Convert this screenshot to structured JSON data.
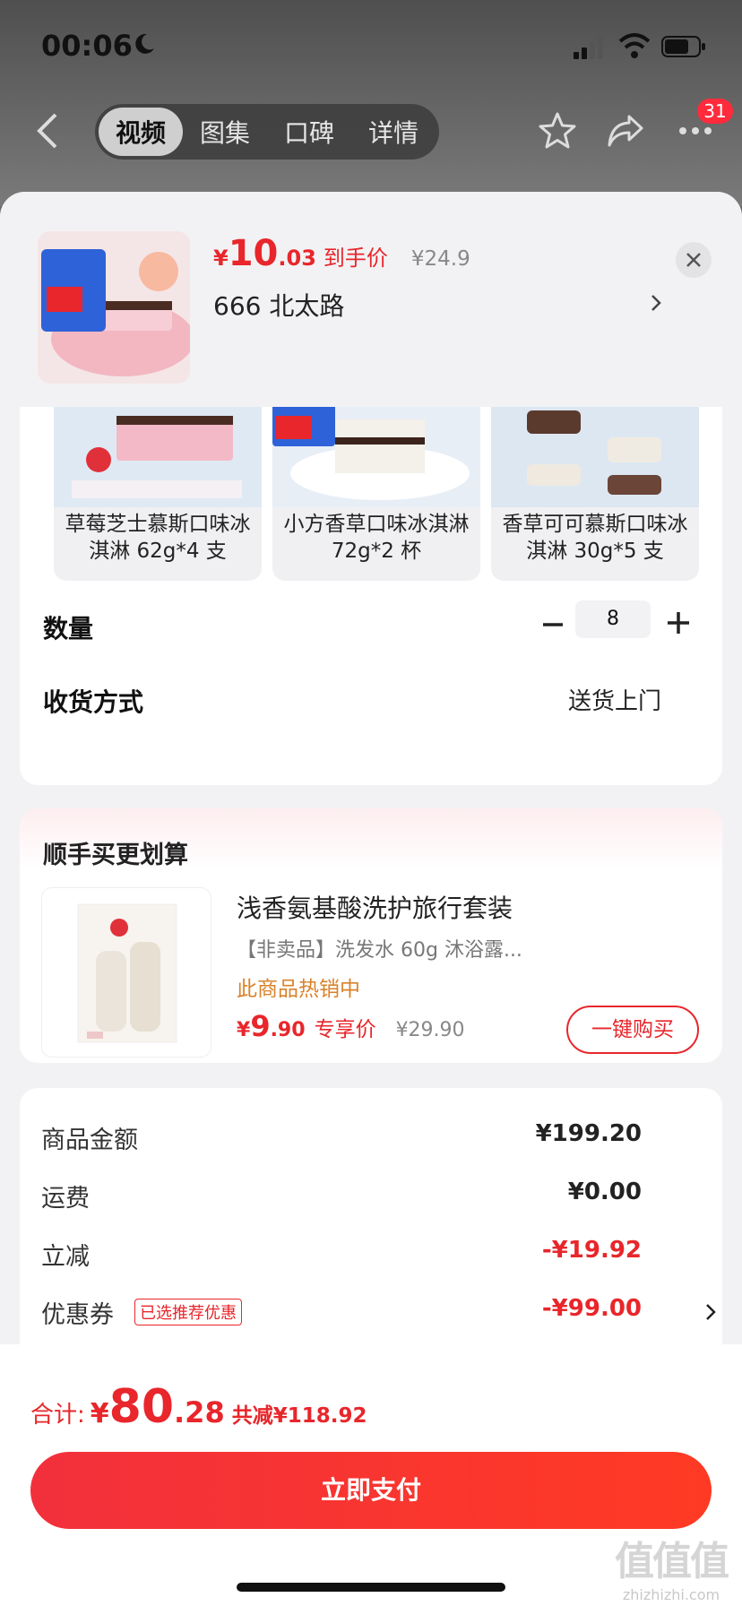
{
  "status_bar": {
    "time": "00:06"
  },
  "nav": {
    "tabs": [
      "视频",
      "图集",
      "口碑",
      "详情"
    ],
    "active_tab": "视频",
    "notification_count": "31"
  },
  "product": {
    "price_symbol": "¥",
    "price_int": "10",
    "price_dec": ".03",
    "price_label": "到手价",
    "original_price": "¥24.9",
    "store_name": "666  北太路"
  },
  "variants": [
    {
      "label": "草莓芝士慕斯口味冰淇淋 62g*4 支"
    },
    {
      "label": "小方香草口味冰淇淋 72g*2 杯"
    },
    {
      "label": "香草可可慕斯口味冰淇淋 30g*5 支"
    }
  ],
  "quantity": {
    "label": "数量",
    "value": "8"
  },
  "delivery": {
    "label": "收货方式",
    "value": "送货上门"
  },
  "addon": {
    "title": "顺手买更划算",
    "name": "浅香氨基酸洗护旅行套装",
    "desc": "【非卖品】洗发水 60g 沐浴露...",
    "hot": "此商品热销中",
    "price_symbol": "¥",
    "price_int": "9",
    "price_dec": ".90",
    "price_label": "专享价",
    "original_price": "¥29.90",
    "buy_label": "一键购买"
  },
  "summary": {
    "subtotal_label": "商品金额",
    "subtotal_value": "¥199.20",
    "shipping_label": "运费",
    "shipping_value": "¥0.00",
    "discount_label": "立减",
    "discount_value": "-¥19.92",
    "coupon_label": "优惠券",
    "coupon_tag": "已选推荐优惠",
    "coupon_value": "-¥99.00"
  },
  "total": {
    "label": "合计:",
    "symbol": "¥",
    "int": "80",
    "dec": ".28",
    "saved": "共减¥118.92"
  },
  "pay_button": "立即支付",
  "watermark": {
    "main": "值值值",
    "sub": "zhizhizhi.com"
  },
  "colors": {
    "accent": "#e8262b",
    "hot_text": "#d9822b",
    "background": "#f2f2f4"
  }
}
